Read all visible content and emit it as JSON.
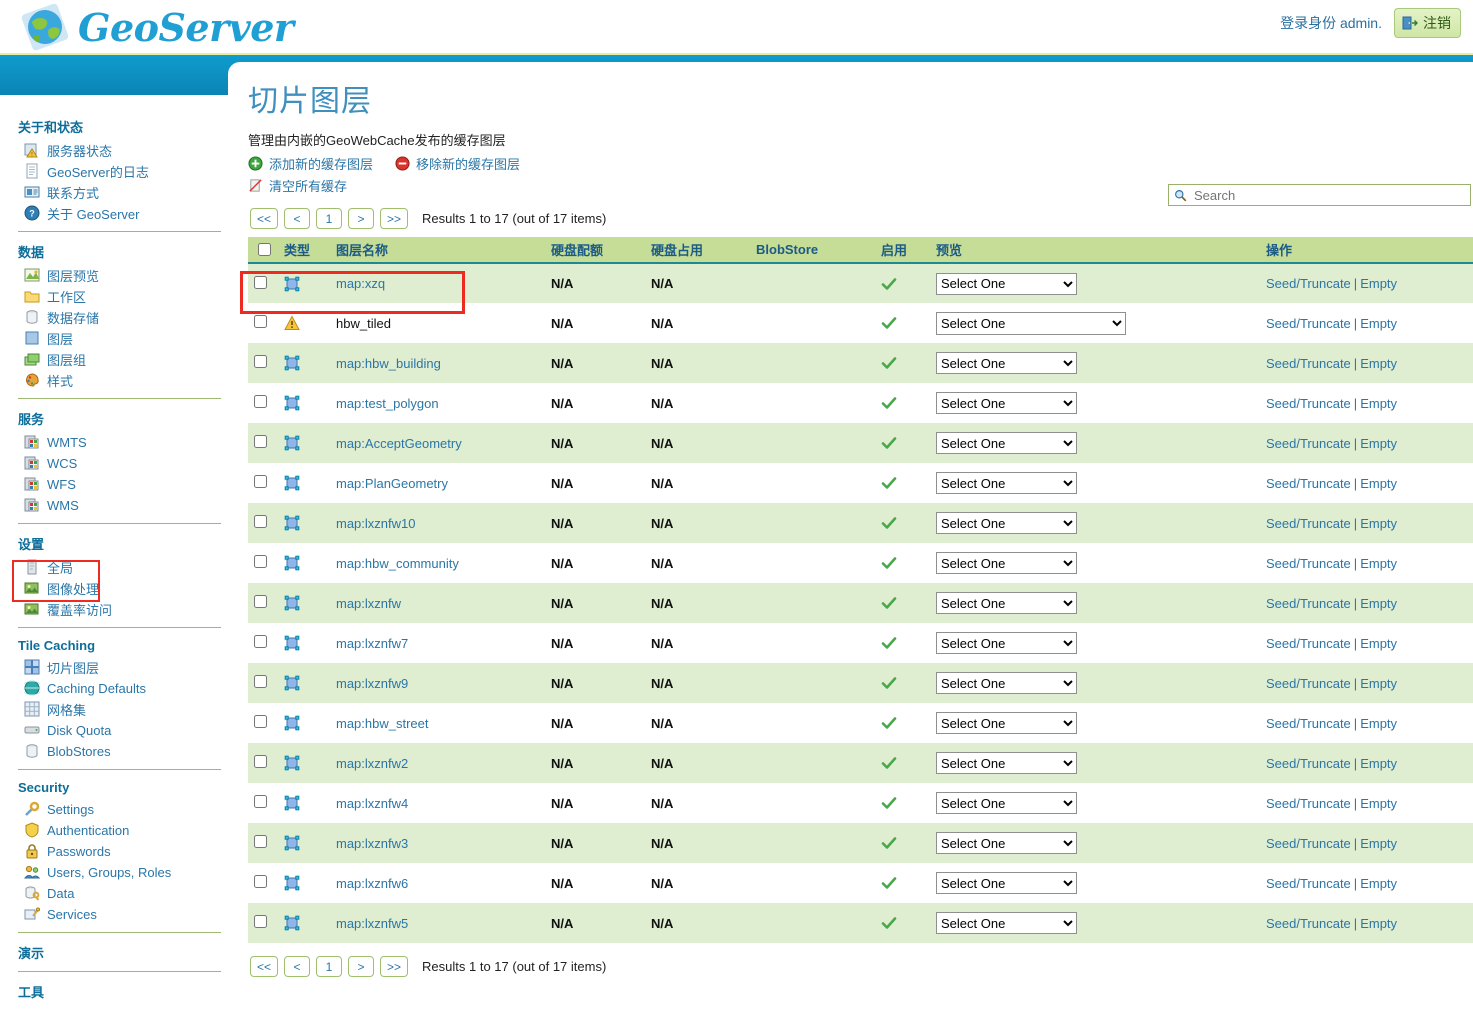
{
  "header": {
    "brand": "GeoServer",
    "login_status": "登录身份 admin.",
    "logout_label": "注销",
    "logo_icon": "globe-icon",
    "logout_icon": "door-exit-icon"
  },
  "sidebar": {
    "sections": [
      {
        "title": "关于和状态",
        "items": [
          {
            "label": "服务器状态",
            "icon": "server-status-icon"
          },
          {
            "label": "GeoServer的日志",
            "icon": "log-page-icon"
          },
          {
            "label": "联系方式",
            "icon": "contact-card-icon"
          },
          {
            "label": "关于 GeoServer",
            "icon": "about-info-icon"
          }
        ]
      },
      {
        "title": "数据",
        "items": [
          {
            "label": "图层预览",
            "icon": "layer-preview-icon"
          },
          {
            "label": "工作区",
            "icon": "workspace-folder-icon"
          },
          {
            "label": "数据存储",
            "icon": "datastore-cylinder-icon"
          },
          {
            "label": "图层",
            "icon": "layer-square-icon"
          },
          {
            "label": "图层组",
            "icon": "layergroup-stack-icon"
          },
          {
            "label": "样式",
            "icon": "style-palette-icon"
          }
        ]
      },
      {
        "title": "服务",
        "items": [
          {
            "label": "WMTS",
            "icon": "service-wmts-icon"
          },
          {
            "label": "WCS",
            "icon": "service-wcs-icon"
          },
          {
            "label": "WFS",
            "icon": "service-wfs-icon"
          },
          {
            "label": "WMS",
            "icon": "service-wms-icon"
          }
        ]
      },
      {
        "title": "设置",
        "items": [
          {
            "label": "全局",
            "icon": "global-settings-icon"
          },
          {
            "label": "图像处理",
            "icon": "image-processing-icon"
          },
          {
            "label": "覆盖率访问",
            "icon": "coverage-access-icon"
          }
        ]
      },
      {
        "title": "Tile Caching",
        "items": [
          {
            "label": "切片图层",
            "icon": "tile-layers-icon"
          },
          {
            "label": "Caching Defaults",
            "icon": "caching-defaults-icon"
          },
          {
            "label": "网格集",
            "icon": "gridsets-icon"
          },
          {
            "label": "Disk Quota",
            "icon": "disk-quota-icon"
          },
          {
            "label": "BlobStores",
            "icon": "blobstores-icon"
          }
        ]
      },
      {
        "title": "Security",
        "items": [
          {
            "label": "Settings",
            "icon": "security-settings-icon"
          },
          {
            "label": "Authentication",
            "icon": "authentication-shield-icon"
          },
          {
            "label": "Passwords",
            "icon": "passwords-lock-icon"
          },
          {
            "label": "Users, Groups, Roles",
            "icon": "users-groups-icon"
          },
          {
            "label": "Data",
            "icon": "data-security-icon"
          },
          {
            "label": "Services",
            "icon": "services-security-icon"
          }
        ]
      },
      {
        "title": "演示",
        "items": []
      },
      {
        "title": "工具",
        "items": []
      }
    ]
  },
  "main": {
    "title": "切片图层",
    "description": "管理由内嵌的GeoWebCache发布的缓存图层",
    "actions": [
      {
        "label": "添加新的缓存图层",
        "icon": "add-circle-icon"
      },
      {
        "label": "移除新的缓存图层",
        "icon": "remove-circle-icon"
      },
      {
        "label": "清空所有缓存",
        "icon": "empty-all-caches-icon"
      }
    ],
    "pager": {
      "first": "<<",
      "prev": "<",
      "page": "1",
      "next": ">",
      "last": ">>",
      "results_text": "Results 1 to 17 (out of 17 items)"
    },
    "search": {
      "placeholder": "Search",
      "value": "",
      "icon": "search-icon"
    },
    "table": {
      "columns": [
        "",
        "类型",
        "图层名称",
        "硬盘配额",
        "硬盘占用",
        "BlobStore",
        "启用",
        "预览",
        "操作"
      ],
      "preview_option": "Select One",
      "ops_seed": "Seed/Truncate",
      "ops_sep": "|",
      "ops_empty": "Empty",
      "rows": [
        {
          "name": "map:xzq",
          "type_icon": "polygon-layer-icon",
          "quota": "N/A",
          "used": "N/A",
          "blobstore": "",
          "enabled": true,
          "is_link": true,
          "highlighted": false
        },
        {
          "name": "hbw_tiled",
          "type_icon": "warning-icon",
          "quota": "N/A",
          "used": "N/A",
          "blobstore": "",
          "enabled": true,
          "is_link": false,
          "highlighted": true
        },
        {
          "name": "map:hbw_building",
          "type_icon": "polygon-layer-icon",
          "quota": "N/A",
          "used": "N/A",
          "blobstore": "",
          "enabled": true,
          "is_link": true,
          "highlighted": false
        },
        {
          "name": "map:test_polygon",
          "type_icon": "polygon-layer-icon",
          "quota": "N/A",
          "used": "N/A",
          "blobstore": "",
          "enabled": true,
          "is_link": true,
          "highlighted": false
        },
        {
          "name": "map:AcceptGeometry",
          "type_icon": "polygon-layer-icon",
          "quota": "N/A",
          "used": "N/A",
          "blobstore": "",
          "enabled": true,
          "is_link": true,
          "highlighted": false
        },
        {
          "name": "map:PlanGeometry",
          "type_icon": "polygon-layer-icon",
          "quota": "N/A",
          "used": "N/A",
          "blobstore": "",
          "enabled": true,
          "is_link": true,
          "highlighted": false
        },
        {
          "name": "map:lxznfw10",
          "type_icon": "polygon-layer-icon",
          "quota": "N/A",
          "used": "N/A",
          "blobstore": "",
          "enabled": true,
          "is_link": true,
          "highlighted": false
        },
        {
          "name": "map:hbw_community",
          "type_icon": "polygon-layer-icon",
          "quota": "N/A",
          "used": "N/A",
          "blobstore": "",
          "enabled": true,
          "is_link": true,
          "highlighted": false
        },
        {
          "name": "map:lxznfw",
          "type_icon": "polygon-layer-icon",
          "quota": "N/A",
          "used": "N/A",
          "blobstore": "",
          "enabled": true,
          "is_link": true,
          "highlighted": false
        },
        {
          "name": "map:lxznfw7",
          "type_icon": "polygon-layer-icon",
          "quota": "N/A",
          "used": "N/A",
          "blobstore": "",
          "enabled": true,
          "is_link": true,
          "highlighted": false
        },
        {
          "name": "map:lxznfw9",
          "type_icon": "polygon-layer-icon",
          "quota": "N/A",
          "used": "N/A",
          "blobstore": "",
          "enabled": true,
          "is_link": true,
          "highlighted": false
        },
        {
          "name": "map:hbw_street",
          "type_icon": "polygon-layer-icon",
          "quota": "N/A",
          "used": "N/A",
          "blobstore": "",
          "enabled": true,
          "is_link": true,
          "highlighted": false
        },
        {
          "name": "map:lxznfw2",
          "type_icon": "polygon-layer-icon",
          "quota": "N/A",
          "used": "N/A",
          "blobstore": "",
          "enabled": true,
          "is_link": true,
          "highlighted": false
        },
        {
          "name": "map:lxznfw4",
          "type_icon": "polygon-layer-icon",
          "quota": "N/A",
          "used": "N/A",
          "blobstore": "",
          "enabled": true,
          "is_link": true,
          "highlighted": false
        },
        {
          "name": "map:lxznfw3",
          "type_icon": "polygon-layer-icon",
          "quota": "N/A",
          "used": "N/A",
          "blobstore": "",
          "enabled": true,
          "is_link": true,
          "highlighted": false
        },
        {
          "name": "map:lxznfw6",
          "type_icon": "polygon-layer-icon",
          "quota": "N/A",
          "used": "N/A",
          "blobstore": "",
          "enabled": true,
          "is_link": true,
          "highlighted": false
        },
        {
          "name": "map:lxznfw5",
          "type_icon": "polygon-layer-icon",
          "quota": "N/A",
          "used": "N/A",
          "blobstore": "",
          "enabled": true,
          "is_link": true,
          "highlighted": false
        }
      ]
    },
    "bottom_pager": {
      "first": "<<",
      "prev": "<",
      "page": "1",
      "next": ">",
      "last": ">>",
      "results_text": "Results 1 to 17 (out of 17 items)"
    }
  },
  "colors": {
    "brand_blue": "#1f9fd4",
    "banner_blue": "#0b84b5",
    "table_header_green": "#c5dd97",
    "row_alt_green": "#dfedd0",
    "link_blue": "#2a76a8",
    "annotation_red": "#ee2b20",
    "title_blue": "#3f8fbf"
  }
}
